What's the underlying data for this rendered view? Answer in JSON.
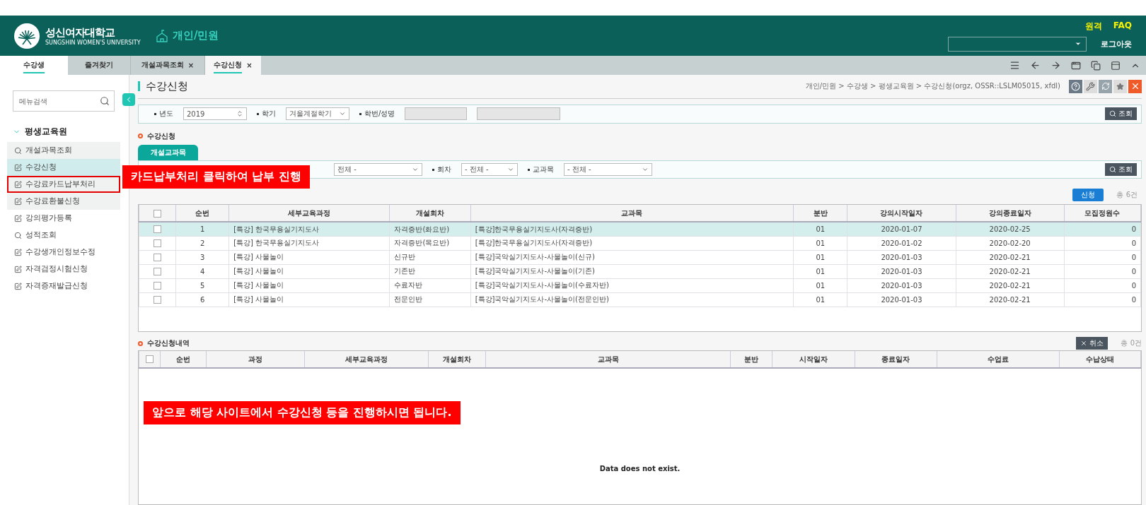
{
  "header": {
    "logo_title": "성신여자대학교",
    "logo_subtitle": "SUNGSHIN WOMEN'S UNIVERSITY",
    "section": "개인/민원",
    "links": [
      "원격",
      "FAQ"
    ],
    "logout": "로그아웃"
  },
  "side_tabs": [
    {
      "label": "수강생",
      "selected": true
    },
    {
      "label": "즐겨찾기",
      "selected": false
    }
  ],
  "page_tabs": [
    {
      "label": "개설과목조회",
      "selected": false,
      "close": "×"
    },
    {
      "label": "수강신청",
      "selected": true,
      "close": "×"
    }
  ],
  "sidebar": {
    "search_placeholder": "메뉴검색",
    "group": {
      "label": "평생교육원",
      "expanded": true,
      "children": [
        {
          "label": "개설과목조회",
          "kind": "search",
          "selected": false,
          "shaded": true,
          "annotated": false
        },
        {
          "label": "수강신청",
          "kind": "edit",
          "selected": true,
          "shaded": true,
          "annotated": false
        },
        {
          "label": "수강료카드납부처리",
          "kind": "edit",
          "selected": false,
          "shaded": true,
          "annotated": true
        },
        {
          "label": "수강료환불신청",
          "kind": "edit",
          "selected": false,
          "shaded": true,
          "annotated": false
        },
        {
          "label": "강의평가등록",
          "kind": "edit",
          "selected": false,
          "shaded": false,
          "annotated": false
        },
        {
          "label": "성적조회",
          "kind": "search",
          "selected": false,
          "shaded": false,
          "annotated": false
        },
        {
          "label": "수강생개인정보수정",
          "kind": "edit",
          "selected": false,
          "shaded": false,
          "annotated": false
        },
        {
          "label": "자격검정시험신청",
          "kind": "edit",
          "selected": false,
          "shaded": false,
          "annotated": false
        },
        {
          "label": "자격증재발급신청",
          "kind": "edit",
          "selected": false,
          "shaded": false,
          "annotated": false
        }
      ]
    }
  },
  "page": {
    "title": "수강신청",
    "breadcrumb": "개인/민원 > 수강생 > 평생교육원 > 수강신청(orgz, OSSR::LSLM05015, xfdl)"
  },
  "search_bar": {
    "fields": [
      {
        "label": "년도",
        "value": "2019",
        "kind": "spin"
      },
      {
        "label": "학기",
        "value": "겨울계절학기",
        "kind": "select"
      },
      {
        "label": "학번/성명",
        "kind": "pair"
      }
    ],
    "button": "조회"
  },
  "section1": {
    "title": "수강신청",
    "tab": "개설교과목",
    "filters": [
      {
        "value": "전체 -",
        "kind": "wide"
      },
      {
        "label": "회차",
        "value": "- 전체 -",
        "kind": "narrow"
      },
      {
        "label": "교과목",
        "value": "- 전체 -",
        "kind": "wide"
      }
    ],
    "button": "조회",
    "apply_button": "신청",
    "count": "총 6건",
    "table": {
      "select_all_checked": false,
      "columns": [
        "순번",
        "세부교육과정",
        "개설회차",
        "교과목",
        "분반",
        "강의시작일자",
        "강의종료일자",
        "모집정원수"
      ],
      "rows": [
        {
          "selected": true,
          "checked": false,
          "cells": [
            "1",
            "[특강] 한국무용실기지도사",
            "자격증반(화요반)",
            "[특강]한국무용실기지도사(자격증반)",
            "01",
            "2020-01-07",
            "2020-02-25",
            "0"
          ]
        },
        {
          "selected": false,
          "checked": false,
          "cells": [
            "2",
            "[특강] 한국무용실기지도사",
            "자격증반(목요반)",
            "[특강]한국무용실기지도사(자격증반)",
            "01",
            "2020-01-02",
            "2020-02-20",
            "0"
          ]
        },
        {
          "selected": false,
          "checked": false,
          "cells": [
            "3",
            "[특강] 사물놀이",
            "신규반",
            "[특강]국악실기지도사-사물놀이(신규)",
            "01",
            "2020-01-03",
            "2020-02-21",
            "0"
          ]
        },
        {
          "selected": false,
          "checked": false,
          "cells": [
            "4",
            "[특강] 사물놀이",
            "기존반",
            "[특강]국악실기지도사-사물놀이(기존)",
            "01",
            "2020-01-03",
            "2020-02-21",
            "0"
          ]
        },
        {
          "selected": false,
          "checked": false,
          "cells": [
            "5",
            "[특강] 사물놀이",
            "수료자반",
            "[특강]국악실기지도사-사물놀이(수료자반)",
            "01",
            "2020-01-03",
            "2020-02-21",
            "0"
          ]
        },
        {
          "selected": false,
          "checked": false,
          "cells": [
            "6",
            "[특강] 사물놀이",
            "전문인반",
            "[특강]국악실기지도사-사물놀이(전문인반)",
            "01",
            "2020-01-03",
            "2020-02-21",
            "0"
          ]
        }
      ]
    }
  },
  "section2": {
    "title": "수강신청내역",
    "cancel_button": "취소",
    "count": "총 0건",
    "select_all_checked": false,
    "columns": [
      "순번",
      "과정",
      "세부교육과정",
      "개설회차",
      "교과목",
      "분반",
      "시작일자",
      "종료일자",
      "수업료",
      "수납상태"
    ],
    "empty": "Data does not exist."
  },
  "annotations": [
    "카드납부처리 클릭하여 납부 진행",
    "앞으로 해당 사이트에서 수강신청 등을 진행하시면 됩니다."
  ]
}
